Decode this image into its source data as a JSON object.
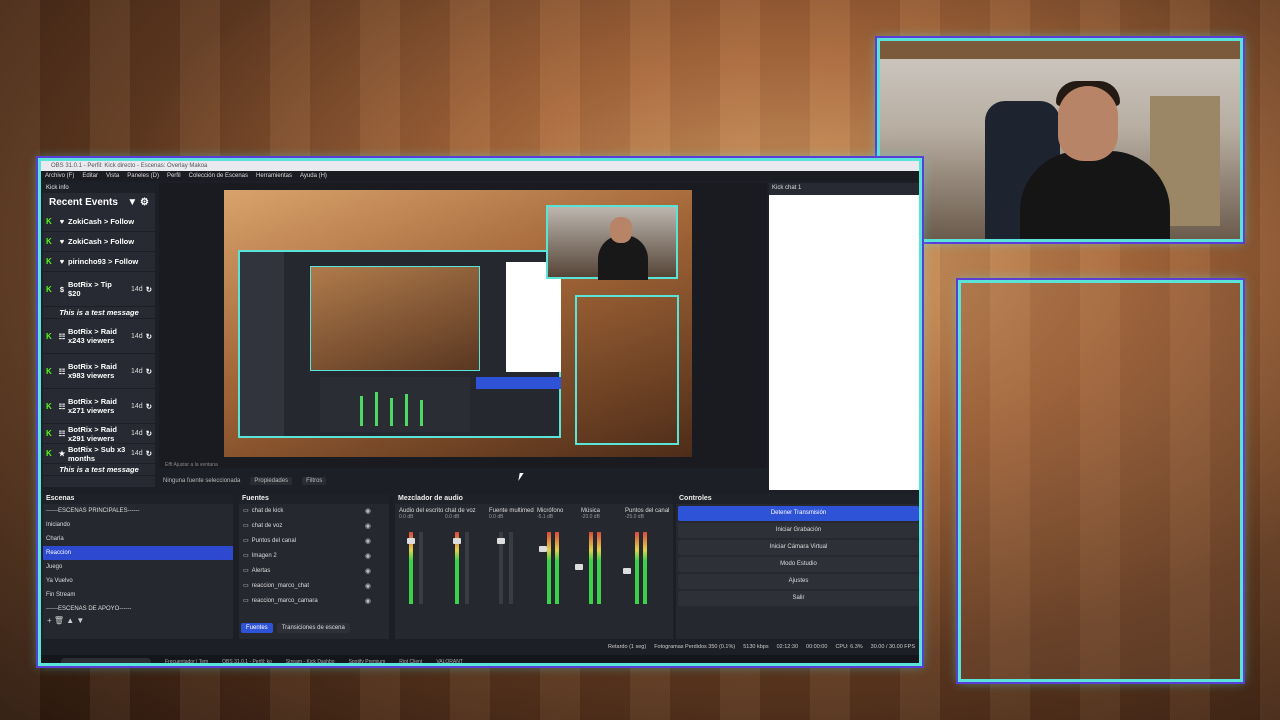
{
  "window": {
    "title": "OBS 31.0.1 - Perfil: Kick directo - Escenas: Overlay Makoa"
  },
  "menu": [
    "Archivo (F)",
    "Editar",
    "Vista",
    "Paneles (D)",
    "Perfil",
    "Colección de Escenas",
    "Herramientas",
    "Ayuda (H)"
  ],
  "kick_info_dock": {
    "title": "Kick info"
  },
  "recent_events": {
    "title": "Recent Events",
    "events": [
      {
        "line1": "ZokiCash",
        "line2": "> Follow",
        "ago": "",
        "kind": "follow"
      },
      {
        "line1": "ZokiCash",
        "line2": "> Follow",
        "ago": "",
        "kind": "follow"
      },
      {
        "line1": "pirincho93",
        "line2": "> Follow",
        "ago": "",
        "kind": "follow"
      },
      {
        "line1": "BotRix > Tip",
        "line2": "$20",
        "ago": "14d",
        "kind": "tip",
        "msg": "This is a test message"
      },
      {
        "line1": "BotRix > Raid",
        "line2": "x243",
        "line3": "viewers",
        "ago": "14d",
        "kind": "raid"
      },
      {
        "line1": "BotRix > Raid",
        "line2": "x983",
        "line3": "viewers",
        "ago": "14d",
        "kind": "raid"
      },
      {
        "line1": "BotRix > Raid",
        "line2": "x271 viewers",
        "ago": "14d",
        "kind": "raid"
      },
      {
        "line1": "BotRix > Raid",
        "line2": "x291 viewers",
        "ago": "14d",
        "kind": "raid"
      },
      {
        "line1": "BotRix > Sub",
        "line2": "x3 months",
        "ago": "14d",
        "kind": "sub",
        "msg": "This is a test message"
      }
    ]
  },
  "preview": {
    "under_label": "Efft     Ajustar a la ventana"
  },
  "chat_dock": {
    "title": "Kick chat 1"
  },
  "source_toolbar": {
    "no_source": "Ninguna fuente seleccionada",
    "properties": "Propiedades",
    "filters": "Filtros"
  },
  "scenes": {
    "title": "Escenas",
    "items": [
      "------ESCENAS PRINCIPALES------",
      "Iniciando",
      "Charla",
      "Reaccion",
      "Juego",
      "Ya Vuelvo",
      "Fin Stream",
      "------ESCENAS DE APOYO------"
    ],
    "selected": 3
  },
  "sources": {
    "title": "Fuentes",
    "items": [
      "chat de kick",
      "chat de voz",
      "Puntos del canal",
      "Imagen 2",
      "Alertas",
      "reaccion_marco_chat",
      "reaccion_marco_camara"
    ]
  },
  "mixer": {
    "title": "Mezclador de audio",
    "channels": [
      {
        "name": "Audio del escrito",
        "db": "0.0 dB"
      },
      {
        "name": "chat de voz",
        "db": "0.0 dB"
      },
      {
        "name": "Fuente multimed",
        "db": "0.0 dB"
      },
      {
        "name": "Micrófono",
        "db": "-5.1 dB"
      },
      {
        "name": "Música",
        "db": "-20.0 dB"
      },
      {
        "name": "Puntos del canal",
        "db": "-25.0 dB"
      }
    ]
  },
  "controls": {
    "title": "Controles",
    "buttons": [
      "Detener Transmisión",
      "Iniciar Grabación",
      "Iniciar Cámara Virtual",
      "Modo Estudio",
      "Ajustes",
      "Salir"
    ]
  },
  "tabs": {
    "sources": "Fuentes",
    "transitions": "Transiciones de escena"
  },
  "status": {
    "delay": "Retardo (1 seg)",
    "dropped": "Fotogramas Perdidos 350 (0.1%)",
    "bitrate": "5130 kbps",
    "live": "02:12:30",
    "rec": "00:00:00",
    "cpu": "CPU: 6.3%",
    "fps": "30.00 / 30.00 FPS"
  },
  "taskbar": {
    "items": [
      "Buscar",
      "Frecuentador | Tem",
      "OBS 31.0.1 - Perfil: ko",
      "Stream - Kick Dashbo",
      "Spotify Premium",
      "Riot Client",
      "VALORANT"
    ]
  },
  "colors": {
    "accent": "#59e3d9",
    "outline": "#5a3fd6",
    "kick_green": "#53fc18",
    "obs_blue": "#2f53d6"
  }
}
